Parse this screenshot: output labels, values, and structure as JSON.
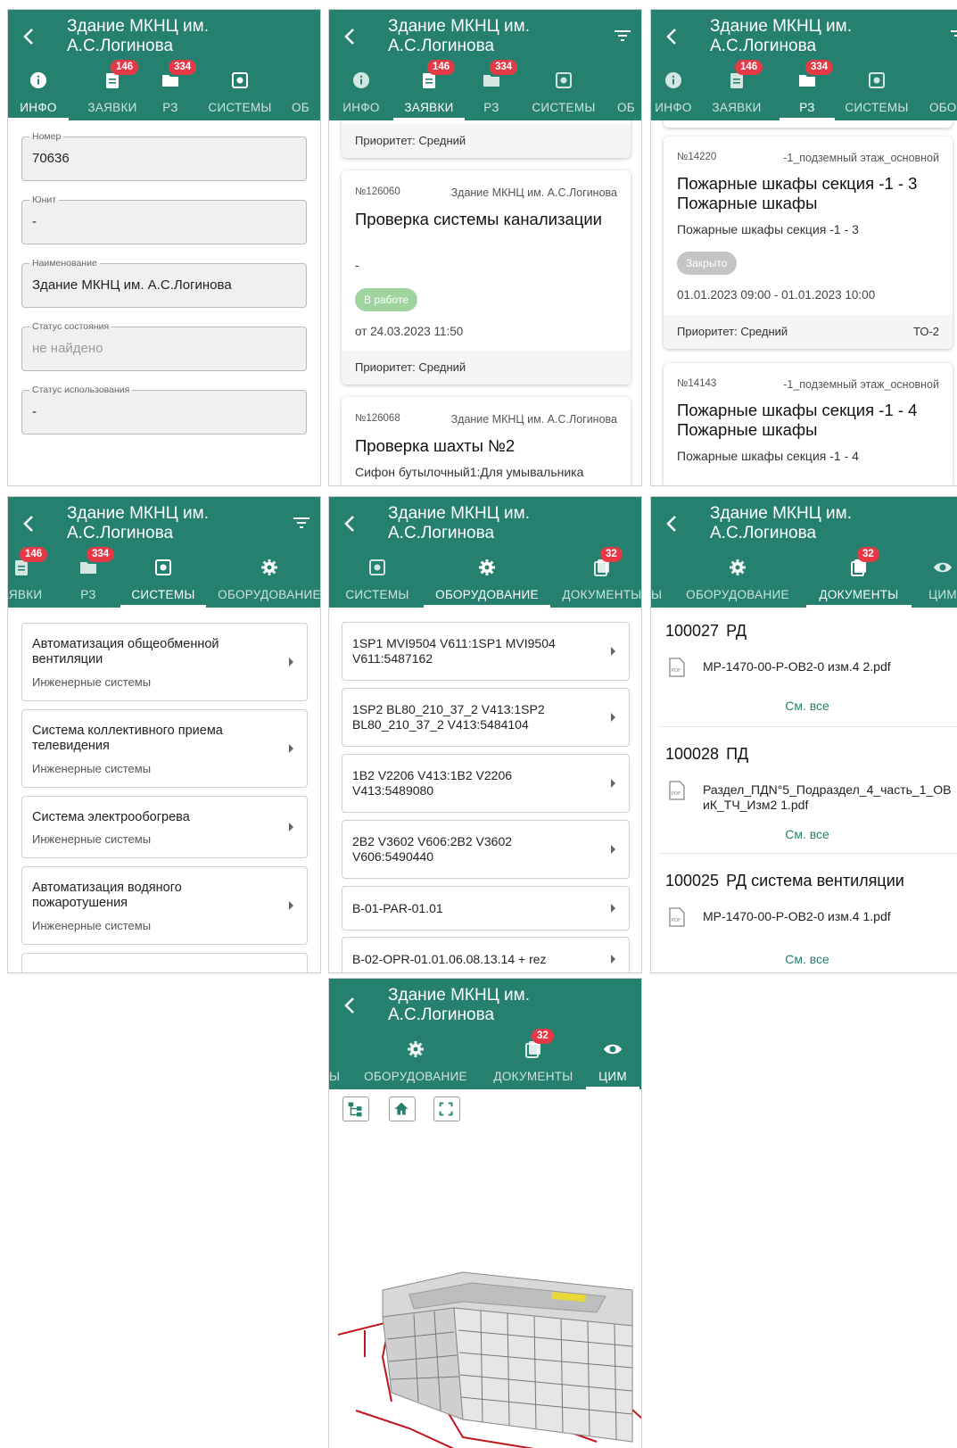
{
  "common": {
    "building_title": "Здание МКНЦ им. А.С.Логинова"
  },
  "tabs": {
    "info": "ИНФО",
    "requests": "ЗАЯВКИ",
    "rz": "РЗ",
    "systems": "СИСТЕМЫ",
    "equipment": "ОБОРУДОВАНИЕ",
    "documents": "ДОКУМЕНТЫ",
    "cim": "ЦИМ",
    "requests_cut": "АЯВКИ",
    "ob_cut": "ОБ",
    "ob_cut2": "ОБО",
    "systems_cut": "Ы",
    "requests_badge": "146",
    "rz_badge": "334",
    "documents_badge": "32"
  },
  "info": {
    "fields": [
      {
        "label": "Номер",
        "value": "70636"
      },
      {
        "label": "Юнит",
        "value": "-"
      },
      {
        "label": "Наименование",
        "value": "Здание МКНЦ им. А.С.Логинова"
      },
      {
        "label": "Статус состояния",
        "value": "не найдено"
      },
      {
        "label": "Статус использования",
        "value": "-"
      }
    ]
  },
  "requests": {
    "partial_priority": "Приоритет: Средний",
    "cards": [
      {
        "number": "№126060",
        "building": "Здание МКНЦ им. А.С.Логинова",
        "title": "Проверка системы канализации",
        "description": "-",
        "status": "В работе",
        "date": "от 24.03.2023 11:50",
        "priority": "Приоритет: Средний"
      },
      {
        "number": "№126068",
        "building": "Здание МКНЦ им. А.С.Логинова",
        "title": "Проверка шахты №2",
        "description": "Сифон бутылочный1:Для умывальника"
      }
    ]
  },
  "rz": {
    "cards": [
      {
        "number": "№14220",
        "location": "-1_подземный этаж_основной",
        "title": "Пожарные шкафы секция -1 - 3 Пожарные шкафы",
        "description": "Пожарные шкафы секция -1 - 3",
        "status": "Закрыто",
        "date": "01.01.2023 09:00 - 01.01.2023 10:00",
        "priority": "Приоритет: Средний",
        "type": "ТО-2"
      },
      {
        "number": "№14143",
        "location": "-1_подземный этаж_основной",
        "title": "Пожарные шкафы секция -1 - 4 Пожарные шкафы",
        "description": "Пожарные шкафы секция -1 - 4"
      }
    ]
  },
  "systems": {
    "items": [
      {
        "name": "Автоматизация общеобменной вентиляции",
        "category": "Инженерные системы"
      },
      {
        "name": "Система коллективного приема телевидения",
        "category": "Инженерные системы"
      },
      {
        "name": "Система электрообогрева",
        "category": "Инженерные системы"
      },
      {
        "name": "Автоматизация водяного пожаротушения",
        "category": "Инженерные системы"
      }
    ]
  },
  "equipment": {
    "items": [
      {
        "name": "1SP1 MVI9504 V611:1SP1 MVI9504 V611:5487162"
      },
      {
        "name": "1SP2 BL80_210_37_2 V413:1SP2 BL80_210_37_2 V413:5484104"
      },
      {
        "name": "1B2 V2206 V413:1B2 V2206 V413:5489080"
      },
      {
        "name": "2B2 V3602 V606:2B2 V3602 V606:5490440"
      },
      {
        "name": "B-01-PAR-01.01"
      },
      {
        "name": "B-02-OPR-01.01.06.08.13.14 + rez"
      }
    ]
  },
  "documents": {
    "see_all": "См. все",
    "groups": [
      {
        "number": "100027",
        "title": "РД",
        "file": "МР-1470-00-Р-ОВ2-0 изм.4 2.pdf"
      },
      {
        "number": "100028",
        "title": "ПД",
        "file": "Раздел_ПДN°5_Подраздел_4_часть_1_ОВиК_ТЧ_Изм2 1.pdf"
      },
      {
        "number": "100025",
        "title": "РД система вентиляции",
        "file": "МР-1470-00-Р-ОВ2-0 изм.4 1.pdf"
      }
    ]
  },
  "colors": {
    "primary": "#26806f",
    "badge": "#e53946",
    "status_in_work": "#9fd49e",
    "status_closed": "#c4c4c4",
    "link": "#26806f"
  },
  "icons": [
    "back-arrow-icon",
    "filter-icon",
    "info-icon",
    "requests-icon",
    "folder-icon",
    "systems-icon",
    "gear-icon",
    "documents-icon",
    "eye-icon",
    "pdf-icon",
    "chevron-right-icon",
    "tree-icon",
    "home-icon",
    "fullscreen-icon"
  ]
}
